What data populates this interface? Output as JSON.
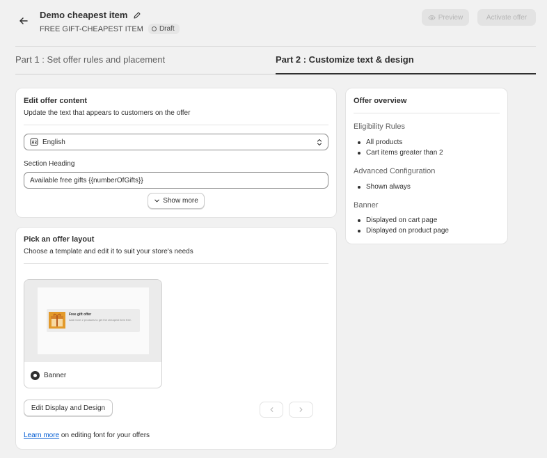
{
  "header": {
    "back_icon": "arrow-left-icon",
    "title": "Demo cheapest item",
    "edit_icon": "pencil-icon",
    "subtitle": "FREE GIFT-CHEAPEST ITEM",
    "status_badge": "Draft",
    "preview_label": "Preview",
    "preview_icon": "eye-icon",
    "activate_label": "Activate offer"
  },
  "tabs": [
    {
      "label": "Part 1 : Set offer rules and placement",
      "active": false
    },
    {
      "label": "Part 2 : Customize text & design",
      "active": true
    }
  ],
  "edit_content": {
    "title": "Edit offer content",
    "description": "Update the text that appears to customers on the offer",
    "language_icon": "translate-icon",
    "language": "English",
    "section_heading_label": "Section Heading",
    "section_heading_value": "Available free gifts {{numberOfGifts}}",
    "show_more_label": "Show more"
  },
  "layout": {
    "title": "Pick an offer layout",
    "description": "Choose a template and edit it to suit your store's needs",
    "preview_banner_title": "Free gift offer",
    "preview_banner_text": "Add more 2 products to get the cheapest item free.",
    "template_name": "Banner",
    "template_selected": true,
    "edit_button": "Edit Display and Design",
    "prev_icon": "chevron-left-icon",
    "next_icon": "chevron-right-icon",
    "footer_link": "Learn more",
    "footer_text": "on editing font for your offers"
  },
  "overview": {
    "title": "Offer overview",
    "sections": [
      {
        "title": "Eligibility Rules",
        "items": [
          "All products",
          "Cart items greater than 2"
        ]
      },
      {
        "title": "Advanced Configuration",
        "items": [
          "Shown always"
        ]
      },
      {
        "title": "Banner",
        "items": [
          "Displayed on cart page",
          "Displayed on product page"
        ]
      }
    ]
  },
  "colors": {
    "accent_dark": "#303030",
    "link": "#005bd3",
    "page_bg": "#f1f1f1"
  }
}
